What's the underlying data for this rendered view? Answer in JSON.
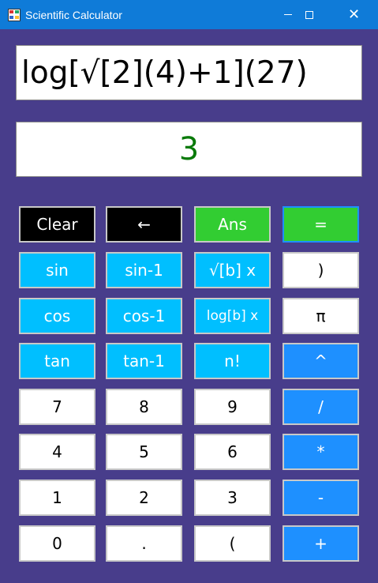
{
  "window": {
    "title": "Scientific Calculator",
    "controls": {
      "minimize": "minimize-icon",
      "maximize": "maximize-icon",
      "close": "close-icon"
    }
  },
  "display": {
    "expression": "log[√[2](4)+1](27)",
    "result": "3",
    "result_color": "#0a7a0a"
  },
  "buttons": {
    "clear": "Clear",
    "backspace": "←",
    "ans": "Ans",
    "equals": "=",
    "sin": "sin",
    "asin": "sin-1",
    "root": "√[b] x",
    "close_paren": ")",
    "cos": "cos",
    "acos": "cos-1",
    "log": "log[b] x",
    "pi": "π",
    "tan": "tan",
    "atan": "tan-1",
    "factorial": "n!",
    "power": "^",
    "d7": "7",
    "d8": "8",
    "d9": "9",
    "divide": "/",
    "d4": "4",
    "d5": "5",
    "d6": "6",
    "multiply": "*",
    "d1": "1",
    "d2": "2",
    "d3": "3",
    "minus": "-",
    "d0": "0",
    "dot": ".",
    "open_paren": "(",
    "plus": "+"
  },
  "colors": {
    "background": "#483d8b",
    "titlebar": "#0f7bd8",
    "function_buttons": "#00bfff",
    "operator_buttons": "#1e90ff",
    "green_buttons": "#32cd32",
    "black_buttons": "#000000"
  }
}
